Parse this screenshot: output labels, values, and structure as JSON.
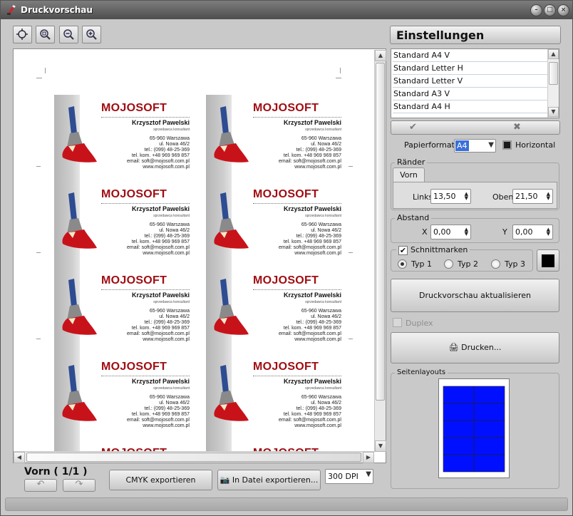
{
  "window": {
    "title": "Druckvorschau"
  },
  "toolbar": {
    "icons": [
      "zoom-fit-icon",
      "zoom-page-icon",
      "zoom-out-icon",
      "zoom-in-icon"
    ]
  },
  "card": {
    "brand": "MOJOSOFT",
    "name": "Krzysztof Pawelski",
    "role": "sprzedawca konsultant",
    "address": [
      "65-960 Warszawa",
      "ul. Nowa 46/2",
      "tel.: (099) 48-25-369",
      "tel. kom. +48 969 969 857",
      "email: soft@mojosoft.com.pl",
      "www.mojosoft.com.pl"
    ],
    "brand_color": "#a00d12"
  },
  "bottom": {
    "page_label": "Vorn ( 1/1 )",
    "cmyk_button": "CMYK exportieren",
    "file_export_button": "In Datei exportieren...",
    "dpi": "300 DPI"
  },
  "settings": {
    "title": "Einstellungen",
    "formats": [
      "Standard A4 V",
      "Standard Letter H",
      "Standard Letter V",
      "Standard A3 V",
      "Standard A4 H"
    ],
    "ok_icon": "checkmark-icon",
    "cancel_icon": "cross-icon",
    "paper_format_label": "Papierformat",
    "paper_format_value": "A4",
    "horizontal_label": "Horizontal",
    "margins": {
      "label": "Ränder",
      "tab": "Vorn",
      "left_label": "Links",
      "left_value": "13,50",
      "top_label": "Oben",
      "top_value": "21,50"
    },
    "spacing": {
      "label": "Abstand",
      "x_label": "X",
      "x_value": "0,00",
      "y_label": "Y",
      "y_value": "0,00"
    },
    "crop_marks": {
      "label": "Schnittmarken",
      "checked": true,
      "options": [
        "Typ 1",
        "Typ 2",
        "Typ 3"
      ],
      "selected": "Typ 1",
      "color": "#000000"
    },
    "update_button": "Druckvorschau aktualisieren",
    "duplex_label": "Duplex",
    "print_button": "Drucken...",
    "layouts_label": "Seitenlayouts",
    "layout_color": "#0010ff"
  }
}
